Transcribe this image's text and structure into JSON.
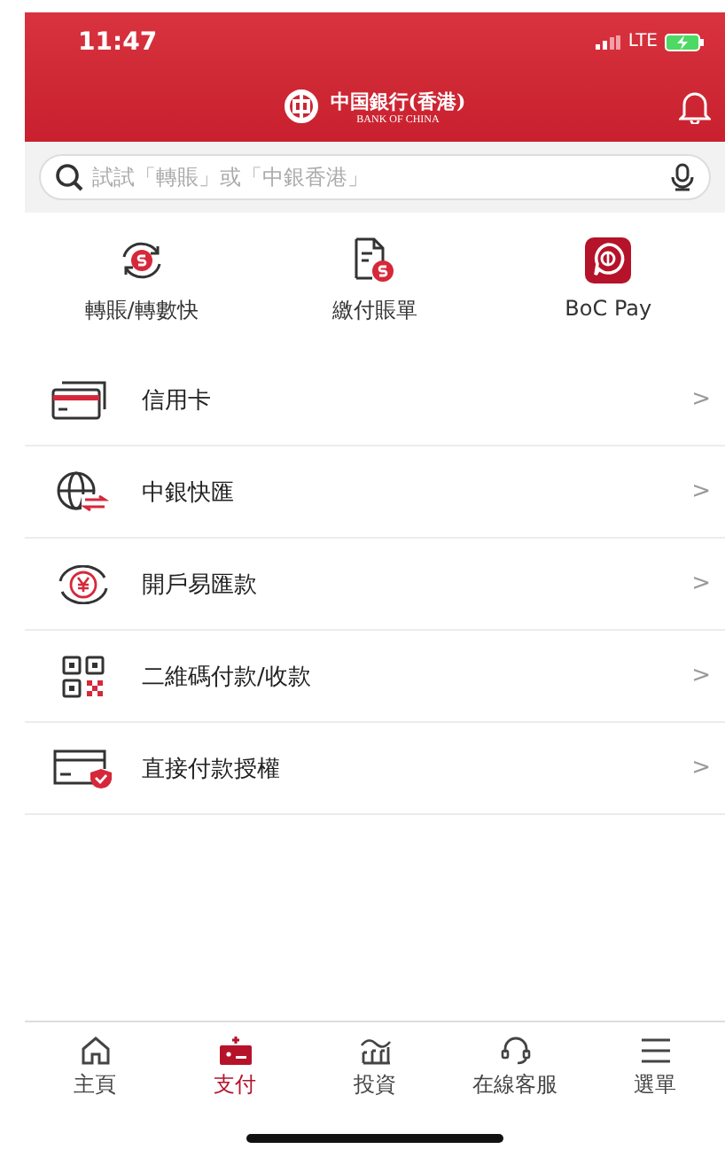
{
  "status_bar": {
    "time": "11:47",
    "network": "LTE"
  },
  "header": {
    "logo_title": "中国銀行(香港)",
    "logo_subtitle": "BANK OF CHINA"
  },
  "search": {
    "placeholder": "試試「轉賬」或「中銀香港」"
  },
  "quick_actions": [
    {
      "label": "轉賬/轉數快"
    },
    {
      "label": "繳付賬單"
    },
    {
      "label": "BoC Pay"
    }
  ],
  "menu_items": [
    {
      "label": "信用卡",
      "arrow": ">"
    },
    {
      "label": "中銀快匯",
      "arrow": ">"
    },
    {
      "label": "開戶易匯款",
      "arrow": ">"
    },
    {
      "label": "二維碼付款/收款",
      "arrow": ">"
    },
    {
      "label": "直接付款授權",
      "arrow": ">"
    }
  ],
  "bottom_nav": [
    {
      "label": "主頁",
      "selected": false
    },
    {
      "label": "支付",
      "selected": true
    },
    {
      "label": "投資",
      "selected": false
    },
    {
      "label": "在線客服",
      "selected": false
    },
    {
      "label": "選單",
      "selected": false
    }
  ]
}
